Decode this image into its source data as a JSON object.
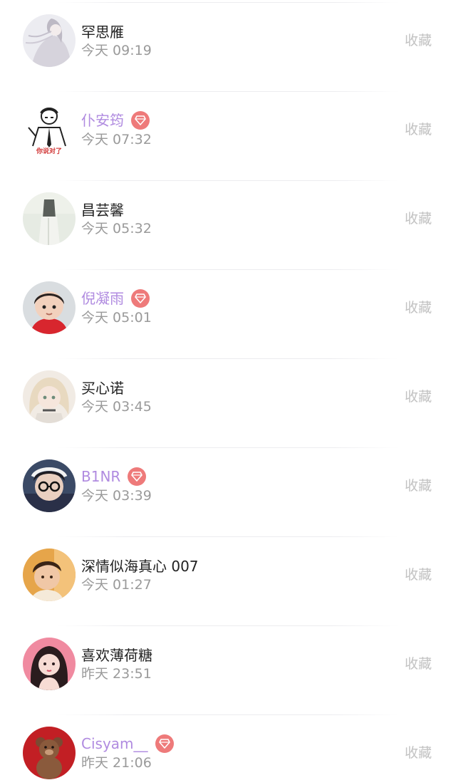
{
  "favorites_list": {
    "items": [
      {
        "name": "罕思雁",
        "time": "今天 09:19",
        "action": "收藏",
        "vip": false,
        "avatar_icon": "user-avatar-anime-girl"
      },
      {
        "name": "仆安筠",
        "time": "今天 07:32",
        "action": "收藏",
        "vip": true,
        "avatar_icon": "user-avatar-meme-man",
        "avatar_caption": "你说对了"
      },
      {
        "name": "昌芸馨",
        "time": "今天 05:32",
        "action": "收藏",
        "vip": false,
        "avatar_icon": "user-avatar-figure"
      },
      {
        "name": "倪凝雨",
        "time": "今天 05:01",
        "action": "收藏",
        "vip": true,
        "avatar_icon": "user-avatar-child"
      },
      {
        "name": "买心诺",
        "time": "今天 03:45",
        "action": "收藏",
        "vip": false,
        "avatar_icon": "user-avatar-anime-blonde"
      },
      {
        "name": "B1NR",
        "time": "今天 03:39",
        "action": "收藏",
        "vip": true,
        "avatar_icon": "user-avatar-glasses-boy"
      },
      {
        "name": "深情似海真心 007",
        "time": "今天 01:27",
        "action": "收藏",
        "vip": false,
        "avatar_icon": "user-avatar-boy-warm"
      },
      {
        "name": "喜欢薄荷糖",
        "time": "昨天 23:51",
        "action": "收藏",
        "vip": false,
        "avatar_icon": "user-avatar-girl-pink"
      },
      {
        "name": "Cisyam__",
        "time": "昨天 21:06",
        "action": "收藏",
        "vip": true,
        "avatar_icon": "user-avatar-teddy-bear"
      }
    ]
  },
  "colors": {
    "vip_name": "#b08be0",
    "vip_badge": "#ee7a7a",
    "name": "#222222",
    "time": "#9a9a9a",
    "action": "#c2c2c2"
  },
  "icons": {
    "vip_badge": "diamond-icon"
  }
}
